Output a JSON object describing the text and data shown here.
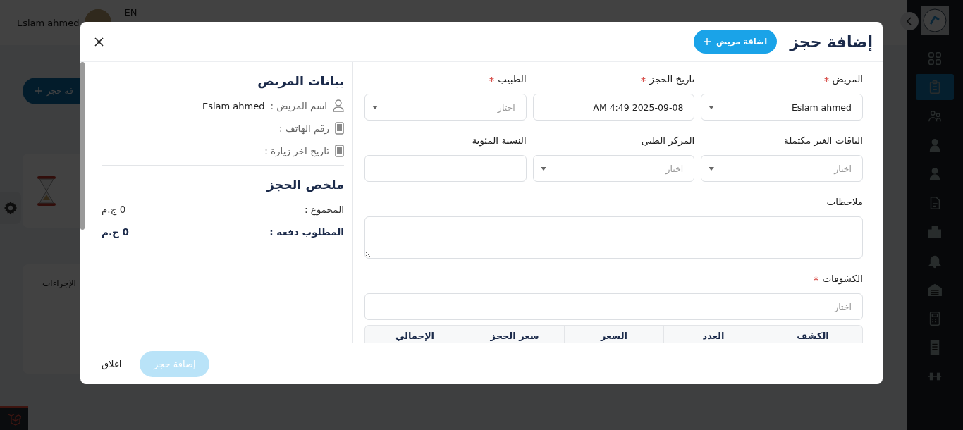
{
  "app": {
    "user_name": "Eslam ahmed",
    "language": "EN",
    "add_button": "فة حجز",
    "card_title": "الإجراءات"
  },
  "nav": {
    "items": [
      {
        "selected": false
      },
      {
        "selected": true
      },
      {
        "selected": false
      },
      {
        "selected": false
      },
      {
        "selected": false
      },
      {
        "selected": false
      },
      {
        "selected": false
      },
      {
        "selected": false
      },
      {
        "selected": false
      },
      {
        "selected": false
      },
      {
        "selected": false
      },
      {
        "selected": false
      }
    ]
  },
  "modal": {
    "title": "إضافة حجز",
    "add_patient_button": "اضافة مريض",
    "fields": [
      {
        "kind": "select",
        "label": "المريض",
        "required": true,
        "value": "Eslam ahmed"
      },
      {
        "kind": "input",
        "label": "تاريخ الحجز",
        "required": true,
        "value": "AM 4:49 2025-09-08"
      },
      {
        "kind": "select",
        "label": "الطبيب",
        "required": true,
        "placeholder": "اختار"
      },
      {
        "kind": "select",
        "label": "الباقات الغير مكتملة",
        "required": false,
        "placeholder": "اختار"
      },
      {
        "kind": "select",
        "label": "المركز الطبي",
        "required": false,
        "placeholder": "اختار"
      },
      {
        "kind": "input",
        "label": "النسبة المئوية",
        "required": false
      },
      {
        "kind": "textarea",
        "label": "ملاحظات",
        "required": false
      },
      {
        "kind": "input",
        "label": "الكشوفات",
        "required": true,
        "placeholder": "اختار"
      }
    ],
    "table": {
      "columns": [
        "الكشف",
        "العدد",
        "السعر",
        "سعر الحجز",
        "الإجمالي"
      ]
    },
    "patient": {
      "title": "بيانات المريض",
      "rows": [
        {
          "label": "اسم المريض :",
          "value": "Eslam ahmed"
        },
        {
          "label": "رقم الهاتف :"
        },
        {
          "label": "تاريخ اخر زيارة :"
        }
      ]
    },
    "summary": {
      "title": "ملخص الحجز",
      "rows": [
        {
          "label": "المجموع :",
          "value": "0 ج.م",
          "emphasis": false
        },
        {
          "label": "المطلوب دفعه :",
          "value": "0 ج.م",
          "emphasis": true
        }
      ]
    },
    "footer": {
      "submit": {
        "label": "إضافة حجز",
        "disabled": true
      },
      "close": "اغلاق"
    }
  }
}
